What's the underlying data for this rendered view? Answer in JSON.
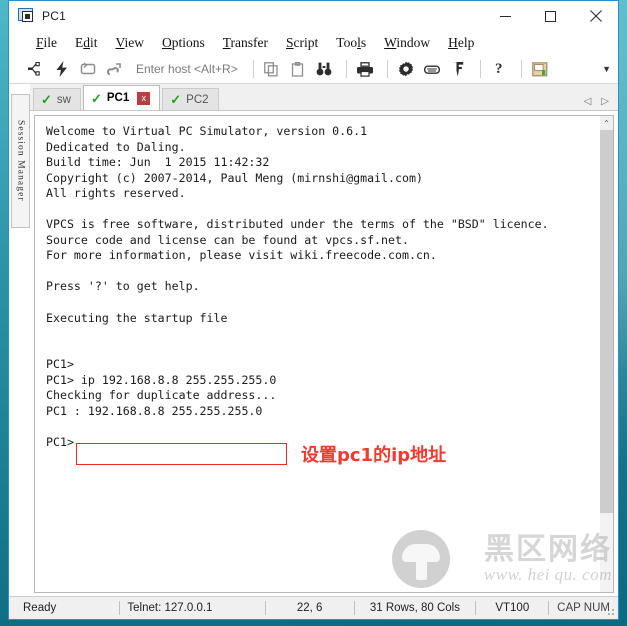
{
  "window": {
    "title": "PC1",
    "icon": "app-window-icon",
    "minimize_label": "Minimize",
    "maximize_label": "Maximize",
    "close_label": "Close"
  },
  "menubar": {
    "items": [
      {
        "label": "File",
        "accel_index": 0
      },
      {
        "label": "Edit",
        "accel_index": 1
      },
      {
        "label": "View",
        "accel_index": 0
      },
      {
        "label": "Options",
        "accel_index": 0
      },
      {
        "label": "Transfer",
        "accel_index": 0
      },
      {
        "label": "Script",
        "accel_index": 0
      },
      {
        "label": "Tools",
        "accel_index": 3
      },
      {
        "label": "Window",
        "accel_index": 0
      },
      {
        "label": "Help",
        "accel_index": 0
      }
    ]
  },
  "toolbar": {
    "host_placeholder": "Enter host <Alt+R>",
    "icons": [
      "connect-icon",
      "quick-connect-icon",
      "reconnect-icon",
      "disconnect-icon",
      "copy-icon",
      "paste-icon",
      "find-icon",
      "print-icon",
      "settings-icon",
      "keymap-icon",
      "key-icon",
      "help-icon",
      "session-options-icon"
    ],
    "overflow_label": "More toolbar buttons"
  },
  "session_manager": {
    "label": "Session Manager"
  },
  "tabs": {
    "items": [
      {
        "label": "sw",
        "active": false,
        "status": "connected"
      },
      {
        "label": "PC1",
        "active": true,
        "status": "connected",
        "close_label": "x"
      },
      {
        "label": "PC2",
        "active": false,
        "status": "connected"
      }
    ],
    "nav_prev": "◁",
    "nav_next": "▷"
  },
  "terminal": {
    "lines": [
      "Welcome to Virtual PC Simulator, version 0.6.1",
      "Dedicated to Daling.",
      "Build time: Jun  1 2015 11:42:32",
      "Copyright (c) 2007-2014, Paul Meng (mirnshi@gmail.com)",
      "All rights reserved.",
      "",
      "VPCS is free software, distributed under the terms of the \"BSD\" licence.",
      "Source code and license can be found at vpcs.sf.net.",
      "For more information, please visit wiki.freecode.com.cn.",
      "",
      "Press '?' to get help.",
      "",
      "Executing the startup file",
      "",
      "",
      "PC1> ",
      "PC1> ip 192.168.8.8 255.255.255.0",
      "Checking for duplicate address...",
      "PC1 : 192.168.8.8 255.255.255.0",
      "",
      "PC1> "
    ],
    "scrollbar": {
      "up_arrow": "⌃",
      "down_arrow": "⌄"
    }
  },
  "annotation": {
    "highlight_command": "ip 192.168.8.8 255.255.255.0",
    "note_text": "设置pc1的ip地址",
    "color": "#f23a2e"
  },
  "watermark": {
    "cjk": "黑区网络",
    "url": "www. hei qu. com"
  },
  "statusbar": {
    "ready": "Ready",
    "connection": "Telnet: 127.0.0.1",
    "cursor": "22,  6",
    "dimensions": "31 Rows, 80 Cols",
    "emulation": "VT100",
    "locks": "CAP NUM"
  }
}
